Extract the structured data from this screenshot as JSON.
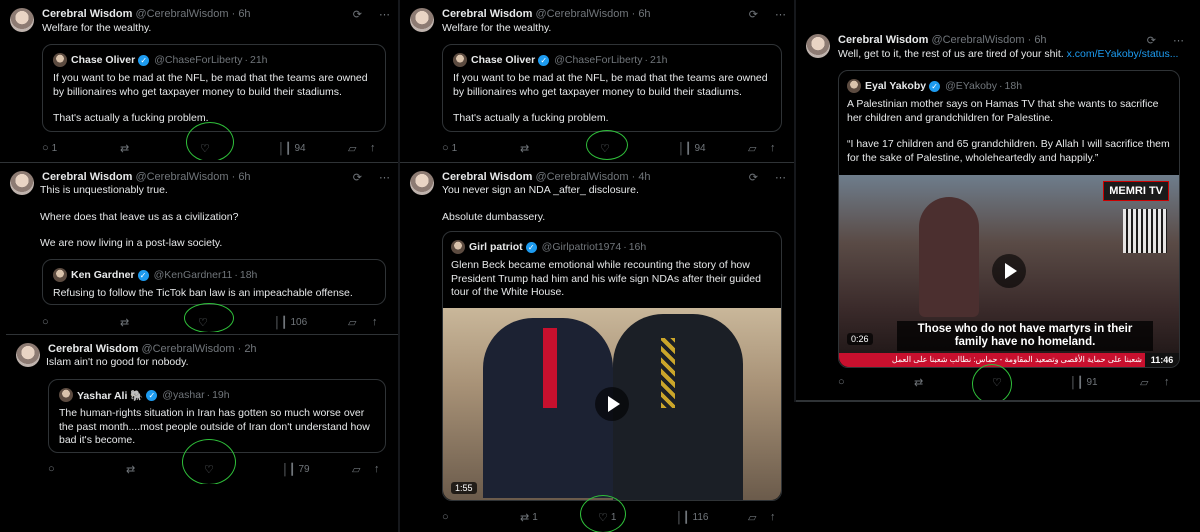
{
  "tweets": [
    {
      "name": "Cerebral Wisdom",
      "handle": "@CerebralWisdom",
      "time": "6h",
      "text": [
        "Welfare for the wealthy."
      ],
      "quote": {
        "name": "Chase Oliver",
        "handle": "@ChaseForLiberty",
        "time": "21h",
        "text": [
          "If you want to be mad at the NFL, be mad that the teams are owned by billionaires who get taxpayer money to build their stadiums.",
          "That's actually a fucking problem."
        ]
      },
      "actions": {
        "replies": "1",
        "reposts": "",
        "likes": "",
        "views": "94"
      }
    },
    {
      "name": "Cerebral Wisdom",
      "handle": "@CerebralWisdom",
      "time": "6h",
      "text": [
        "Welfare for the wealthy."
      ],
      "quote": {
        "name": "Chase Oliver",
        "handle": "@ChaseForLiberty",
        "time": "21h",
        "text": [
          "If you want to be mad at the NFL, be mad that the teams are owned by billionaires who get taxpayer money to build their stadiums.",
          "That's actually a fucking problem."
        ]
      },
      "actions": {
        "replies": "1",
        "reposts": "",
        "likes": "",
        "views": "94"
      }
    },
    {
      "name": "Cerebral Wisdom",
      "handle": "@CerebralWisdom",
      "time": "6h",
      "text_prefix": "Well, get to it, the rest of us are tired of your shit.",
      "text_link": "x.com/EYakoby/status...",
      "quote": {
        "name": "Eyal Yakoby",
        "handle": "@EYakoby",
        "time": "18h",
        "text": [
          "A Palestinian mother says on Hamas TV that she wants to sacrifice her children and grandchildren for Palestine.",
          "“I have 17 children and 65 grandchildren. By Allah I will sacrifice them for the sake of Palestine, wholeheartedly and happily.”"
        ],
        "video": {
          "caption": "Those who do not have martyrs in their family have no homeland.",
          "duration": "0:26",
          "clock": "11:46",
          "brand": "MEMRI TV",
          "ticker": "شعبنا على حماية الأقصى وتصعيد المقاومة - حماس: نطالب شعبنا على العمل"
        }
      },
      "actions": {
        "replies": "",
        "reposts": "",
        "likes": "",
        "views": "91"
      }
    },
    {
      "name": "Cerebral Wisdom",
      "handle": "@CerebralWisdom",
      "time": "6h",
      "text": [
        "This is unquestionably true.",
        "Where does that leave us as a civilization?",
        "We are now living in a post-law society."
      ],
      "quote": {
        "name": "Ken Gardner",
        "handle": "@KenGardner11",
        "time": "18h",
        "text": [
          "Refusing to follow the TicTok ban law is an impeachable offense."
        ]
      },
      "actions": {
        "replies": "",
        "reposts": "",
        "likes": "",
        "views": "106"
      }
    },
    {
      "name": "Cerebral Wisdom",
      "handle": "@CerebralWisdom",
      "time": "4h",
      "text": [
        "You never sign an NDA _after_ disclosure.",
        "Absolute dumbassery."
      ],
      "quote": {
        "name": "Girl patriot",
        "handle": "@Girlpatriot1974",
        "time": "16h",
        "text": [
          "Glenn Beck became emotional while recounting the story of how President Trump had him and his wife sign NDAs after their guided tour of the White House."
        ],
        "video": {
          "duration": "1:55"
        }
      },
      "actions": {
        "replies": "",
        "reposts": "1",
        "likes": "1",
        "views": "116"
      }
    },
    {
      "name": "Cerebral Wisdom",
      "handle": "@CerebralWisdom",
      "time": "2h",
      "text": [
        "Islam ain't no good for nobody."
      ],
      "quote": {
        "name": "Yashar Ali 🐘",
        "handle": "@yashar",
        "time": "19h",
        "text": [
          "The human-rights situation in Iran has gotten so much worse over the past month....most people outside of Iran don't understand how bad it's become."
        ]
      },
      "actions": {
        "replies": "",
        "reposts": "",
        "likes": "",
        "views": "79"
      }
    }
  ],
  "icons": {
    "grok": "⟳",
    "more": "⋯",
    "reply": "○",
    "repost": "⇄",
    "like": "♡",
    "views": "│┃",
    "bookmark": "▱",
    "share": "↑"
  },
  "colors": {
    "background": "#000000",
    "accent": "#1d9bf0",
    "muted": "#71767b",
    "annotation": "#2fbf3a"
  }
}
